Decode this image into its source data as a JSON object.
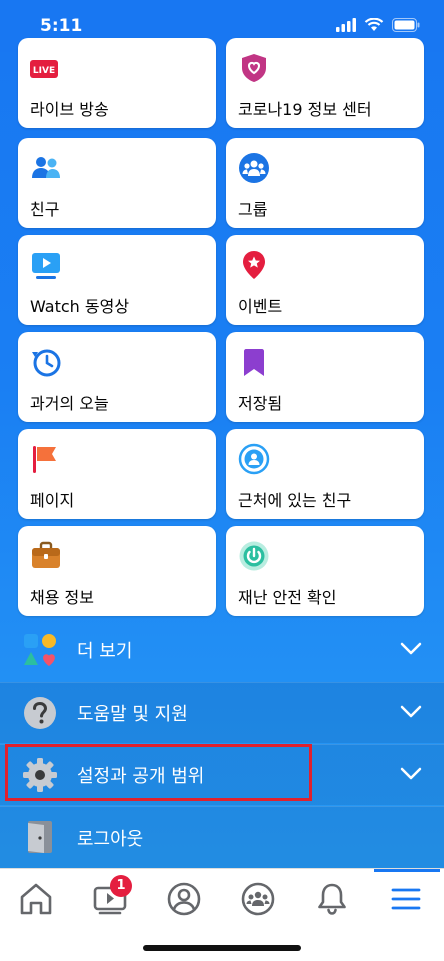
{
  "status": {
    "time": "5:11"
  },
  "shortcuts": [
    {
      "label": "라이브 방송",
      "icon": "live-icon"
    },
    {
      "label": "코로나19 정보 센터",
      "icon": "covid-shield-icon"
    },
    {
      "label": "친구",
      "icon": "friends-icon"
    },
    {
      "label": "그룹",
      "icon": "groups-icon"
    },
    {
      "label": "Watch 동영상",
      "icon": "watch-icon"
    },
    {
      "label": "이벤트",
      "icon": "event-pin-icon"
    },
    {
      "label": "과거의 오늘",
      "icon": "memories-clock-icon"
    },
    {
      "label": "저장됨",
      "icon": "saved-bookmark-icon"
    },
    {
      "label": "페이지",
      "icon": "pages-flag-icon"
    },
    {
      "label": "근처에 있는 친구",
      "icon": "nearby-friends-icon"
    },
    {
      "label": "채용 정보",
      "icon": "jobs-briefcase-icon"
    },
    {
      "label": "재난 안전 확인",
      "icon": "crisis-response-icon"
    }
  ],
  "live_badge": "LIVE",
  "menu": {
    "see_more": "더 보기",
    "help": "도움말 및 지원",
    "settings": "설정과 공개 범위",
    "logout": "로그아웃"
  },
  "tabbar": {
    "video_badge": "1"
  },
  "colors": {
    "brand": "#1877f2",
    "highlight": "#e0212e"
  }
}
